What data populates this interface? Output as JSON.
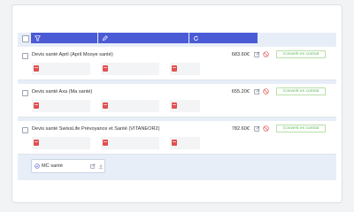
{
  "toolbar": {
    "buttons": [
      {
        "icon": "filter-icon"
      },
      {
        "icon": "pencil-icon"
      },
      {
        "icon": "refresh-icon"
      }
    ]
  },
  "rows": [
    {
      "title": "Devis santé April (April Mooye santé)",
      "price": "683.60€",
      "action": "Converti en contrat",
      "docs": 3
    },
    {
      "title": "Devis santé Axa (Ma santé)",
      "price": "655.20€",
      "action": "Converti en contrat",
      "docs": 3
    },
    {
      "title": "Devis santé SwissLife Prévoyance et Santé (VITANEOR2)",
      "price": "782.60€",
      "action": "Converti en contrat",
      "docs": 3
    }
  ],
  "file": {
    "label": "MC santé"
  },
  "colors": {
    "accent": "#4b5bd6",
    "success": "#5cb85c",
    "danger": "#e05050"
  }
}
